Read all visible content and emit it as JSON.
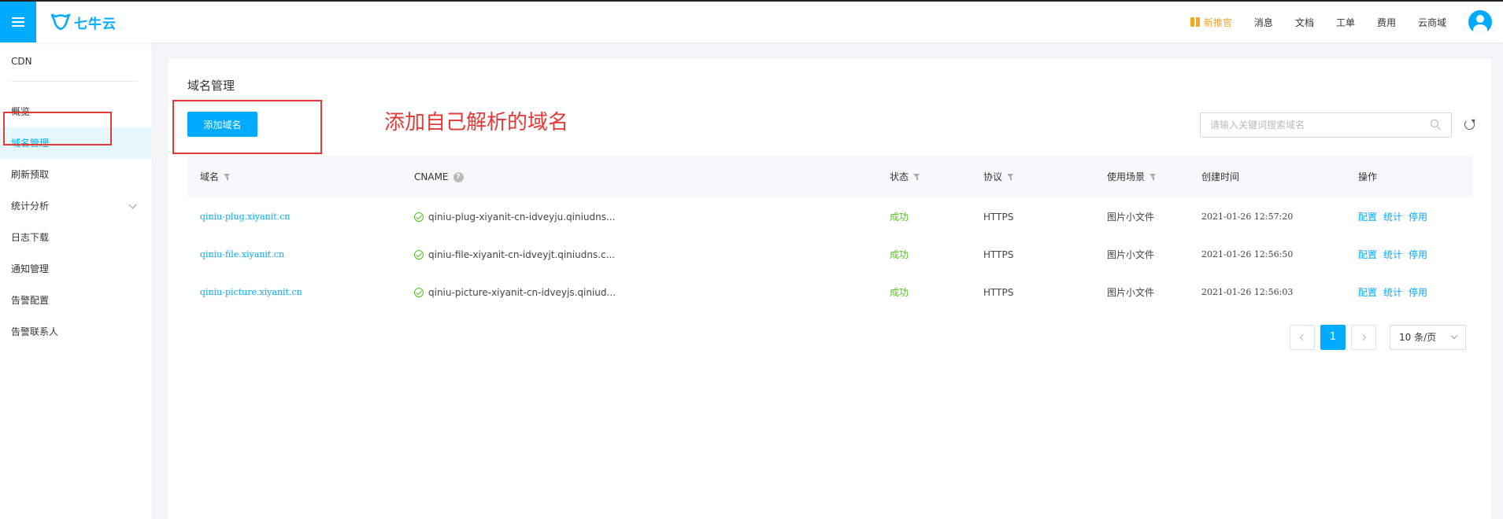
{
  "header": {
    "logo_text": "七牛云",
    "nav": [
      "消息",
      "文档",
      "工单",
      "费用",
      "云商域"
    ],
    "new_user": "新推官"
  },
  "sidebar": {
    "title": "CDN",
    "items": [
      {
        "label": "概览"
      },
      {
        "label": "域名管理",
        "active": true
      },
      {
        "label": "刷新预取"
      },
      {
        "label": "统计分析",
        "expandable": true
      },
      {
        "label": "日志下载"
      },
      {
        "label": "通知管理"
      },
      {
        "label": "告警配置"
      },
      {
        "label": "告警联系人"
      }
    ]
  },
  "main": {
    "title": "域名管理",
    "add_button": "添加域名",
    "annotation": "添加自己解析的域名",
    "search_placeholder": "请输入关键词搜索域名",
    "table": {
      "headers": [
        "域名",
        "CNAME",
        "状态",
        "协议",
        "使用场景",
        "创建时间",
        "操作"
      ],
      "rows": [
        {
          "domain": "qiniu-plug.xiyanit.cn",
          "cname": "qiniu-plug-xiyanit-cn-idveyju.qiniudns...",
          "status": "成功",
          "protocol": "HTTPS",
          "scene": "图片小文件",
          "created": "2021-01-26 12:57:20"
        },
        {
          "domain": "qiniu-file.xiyanit.cn",
          "cname": "qiniu-file-xiyanit-cn-idveyjt.qiniudns.c...",
          "status": "成功",
          "protocol": "HTTPS",
          "scene": "图片小文件",
          "created": "2021-01-26 12:56:50"
        },
        {
          "domain": "qiniu-picture.xiyanit.cn",
          "cname": "qiniu-picture-xiyanit-cn-idveyjs.qiniud...",
          "status": "成功",
          "protocol": "HTTPS",
          "scene": "图片小文件",
          "created": "2021-01-26 12:56:03"
        }
      ],
      "actions": [
        "配置",
        "统计",
        "停用"
      ]
    },
    "pagination": {
      "current": "1",
      "page_size": "10 条/页"
    }
  },
  "colors": {
    "accent": "#00aaff",
    "success": "#52c41a",
    "annotation": "#e53935",
    "new_user": "#f5a623"
  }
}
